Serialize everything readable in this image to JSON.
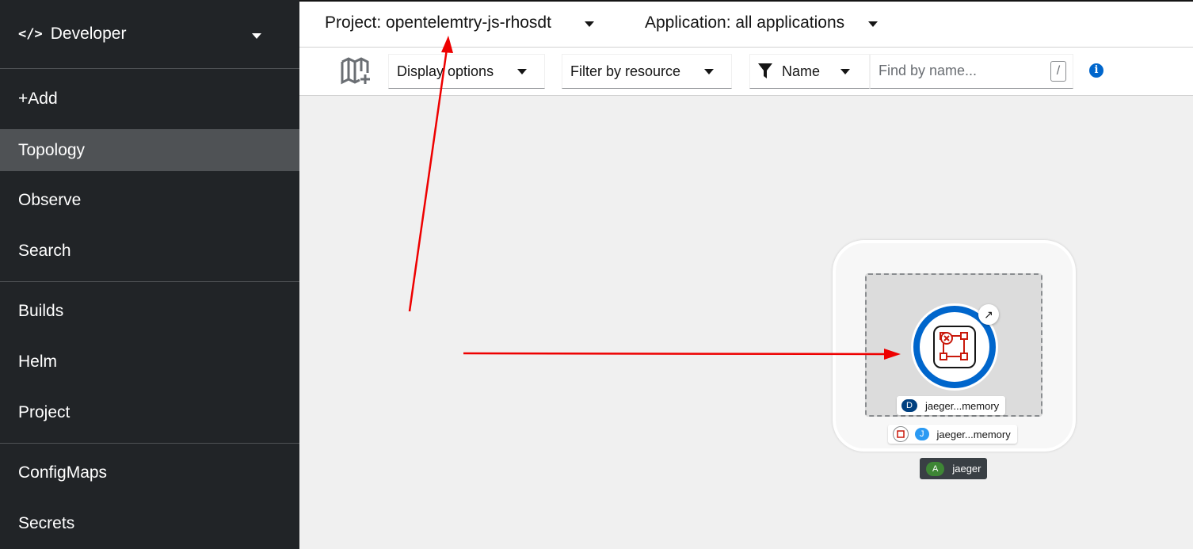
{
  "sidebar": {
    "perspective": {
      "icon": "code-icon",
      "label": "Developer"
    },
    "items": [
      {
        "label": "+Add"
      },
      {
        "label": "Topology",
        "active": true
      },
      {
        "label": "Observe"
      },
      {
        "label": "Search"
      },
      {
        "label": "Builds"
      },
      {
        "label": "Helm"
      },
      {
        "label": "Project"
      },
      {
        "label": "ConfigMaps"
      },
      {
        "label": "Secrets"
      }
    ]
  },
  "topbar": {
    "project": "Project: opentelemtry-js-rhosdt",
    "application": "Application: all applications"
  },
  "toolbar": {
    "catalog_icon": "book-add-icon",
    "display_options": "Display options",
    "filter_by_resource": "Filter by resource",
    "filter_type": "Name",
    "search_placeholder": "Find by name...",
    "search_shortcut": "/",
    "info_icon": "info-circle-icon"
  },
  "topology": {
    "deployment_label": {
      "badge": "D",
      "name": "jaeger...memory",
      "badge_color": "#004080"
    },
    "jaeger_label": {
      "badge": "J",
      "name": "jaeger...memory",
      "badge_color": "#2b9af3"
    },
    "app_label": {
      "badge": "A",
      "name": "jaeger",
      "badge_color": "#3e8635"
    }
  },
  "colors": {
    "accent": "#0066cc",
    "annotation_arrow": "#ee0000",
    "sidebar_bg": "#212427"
  }
}
